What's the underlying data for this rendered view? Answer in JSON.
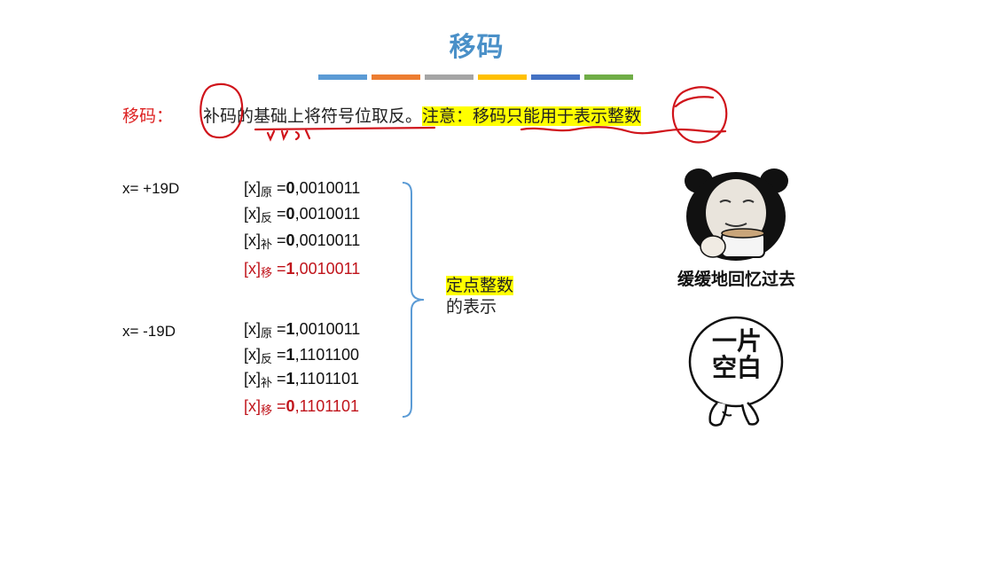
{
  "title": "移码",
  "color_bar": [
    "#5b9bd5",
    "#ed7d31",
    "#a5a5a5",
    "#ffc000",
    "#4472c4",
    "#70ad47"
  ],
  "definition": {
    "label": "移码：",
    "text": "补码的基础上将符号位取反。",
    "note": "注意：移码只能用于表示整数"
  },
  "examples": [
    {
      "x": "x= +19D",
      "rows": [
        {
          "prefix": "[x]",
          "sub": "原",
          "eq": " =",
          "sign": "0",
          "rest": ",0010011",
          "red": false
        },
        {
          "prefix": "[x]",
          "sub": "反",
          "eq": " =",
          "sign": "0",
          "rest": ",0010011",
          "red": false
        },
        {
          "prefix": "[x]",
          "sub": "补",
          "eq": " =",
          "sign": "0",
          "rest": ",0010011",
          "red": false
        },
        {
          "prefix": "[x]",
          "sub": "移",
          "eq": " =",
          "sign": "1",
          "rest": ",0010011",
          "red": true
        }
      ]
    },
    {
      "x": "x= -19D",
      "rows": [
        {
          "prefix": "[x]",
          "sub": "原",
          "eq": " =",
          "sign": "1",
          "rest": ",0010011",
          "red": false
        },
        {
          "prefix": "[x]",
          "sub": "反",
          "eq": " =",
          "sign": "1",
          "rest": ",1101100",
          "red": false
        },
        {
          "prefix": "[x]",
          "sub": "补",
          "eq": " =",
          "sign": "1",
          "rest": ",1101101",
          "red": false
        },
        {
          "prefix": "[x]",
          "sub": "移",
          "eq": " =",
          "sign": "0",
          "rest": ",1101101",
          "red": true
        }
      ]
    }
  ],
  "brace_note": {
    "line1": "定点整数",
    "line2": "的表示"
  },
  "memes": [
    {
      "caption": "缓缓地回忆过去",
      "icon": "panda-drinking-tea-icon"
    },
    {
      "caption_line1": "一片",
      "caption_line2": "空白",
      "icon": "blank-mind-character-icon"
    }
  ]
}
